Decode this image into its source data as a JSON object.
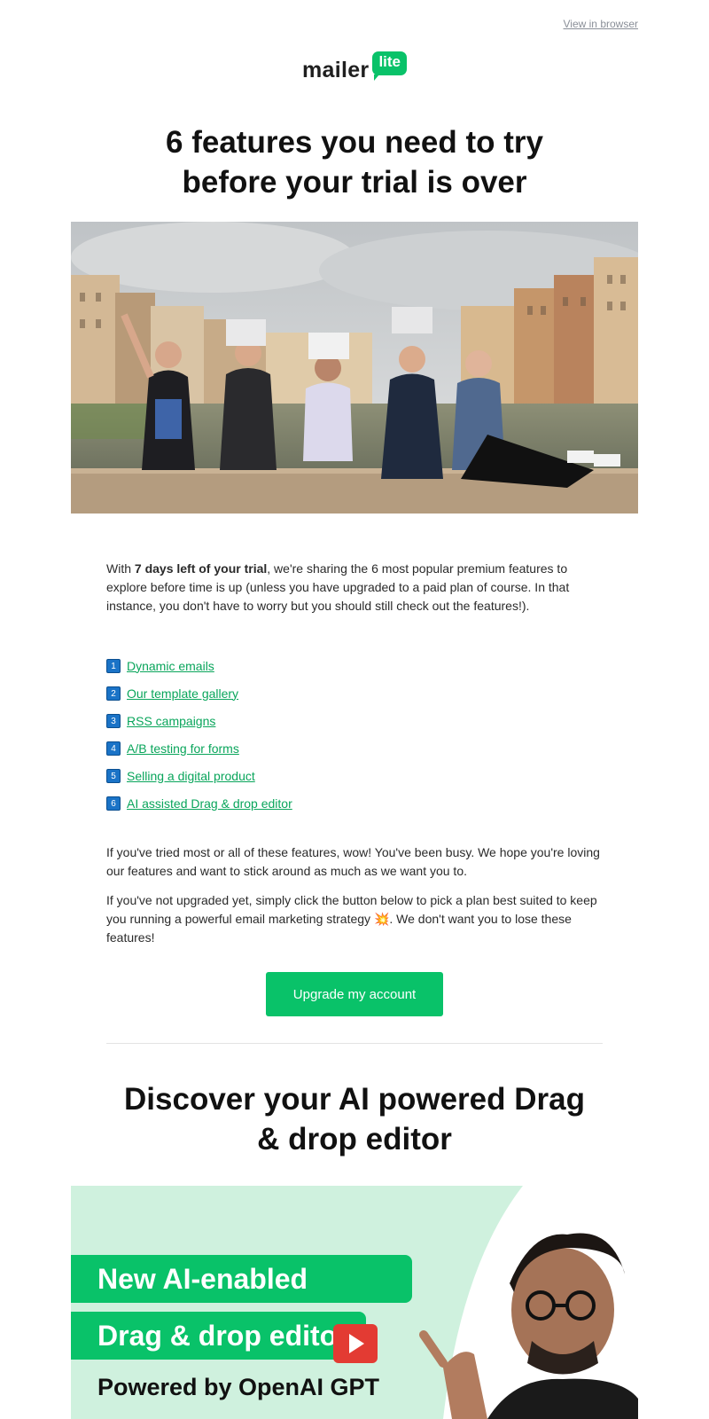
{
  "header": {
    "view_in_browser": "View in browser",
    "logo_word": "mailer",
    "logo_badge": "lite"
  },
  "title": {
    "line1": "6 features you need to try",
    "line2": "before your trial is over"
  },
  "intro": {
    "prefix": "With ",
    "bold": "7 days left of your trial",
    "suffix": ", we're sharing the 6 most popular premium features to explore before time is up (unless you have upgraded to a paid plan of course. In that instance, you don't have to worry but you should still check out the features!)."
  },
  "features": [
    {
      "num": "1",
      "label": "Dynamic emails"
    },
    {
      "num": "2",
      "label": "Our template gallery"
    },
    {
      "num": "3",
      "label": "RSS campaigns"
    },
    {
      "num": "4",
      "label": "A/B testing for forms"
    },
    {
      "num": "5",
      "label": "Selling a digital product"
    },
    {
      "num": "6",
      "label": "AI assisted Drag & drop editor"
    }
  ],
  "para2": "If you've tried most or all of these features, wow! You've been busy. We hope you're loving our features and want to stick around as much as we want you to.",
  "para3": {
    "before": "If you've not upgraded yet, simply click the button below to pick a plan best suited to keep you running a powerful email marketing strategy ",
    "emoji": "💥",
    "after": ". We don't want you to lose these features!"
  },
  "cta_label": "Upgrade my account",
  "section2": {
    "line1": "Discover your AI powered Drag",
    "line2": "& drop editor"
  },
  "video": {
    "line1": "New AI-enabled",
    "line2": "Drag & drop edito",
    "line3": "Powered by OpenAI GPT"
  },
  "colors": {
    "brand_green": "#09c269",
    "link_green": "#09a55b",
    "number_badge": "#1a73c7",
    "video_bg": "#cff1de",
    "play_red": "#e33b33"
  }
}
